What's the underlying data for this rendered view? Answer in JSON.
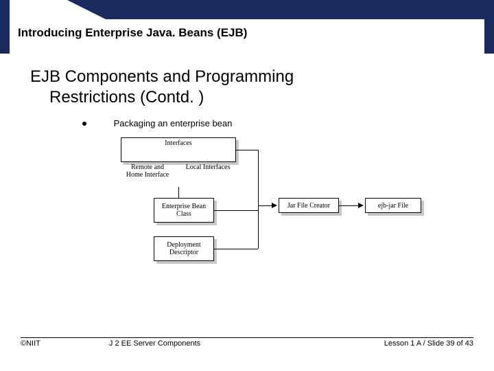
{
  "header": {
    "title": "Introducing Enterprise Java. Beans (EJB)"
  },
  "content": {
    "heading_line1": "EJB Components and Programming",
    "heading_line2": "Restrictions (Contd. )",
    "bullet": "Packaging an enterprise bean"
  },
  "diagram": {
    "interfaces_box": "Interfaces",
    "remote_home_label": "Remote and Home Interface",
    "local_interfaces_label": "Local Interfaces",
    "enterprise_bean_class": "Enterprise Bean Class",
    "deployment_descriptor": "Deployment Descriptor",
    "jar_file_creator": "Jar File Creator",
    "ejb_jar_file": "ejb-jar File"
  },
  "footer": {
    "copyright": "©NIIT",
    "center": "J 2 EE Server Components",
    "right": "Lesson 1 A / Slide 39 of 43"
  }
}
